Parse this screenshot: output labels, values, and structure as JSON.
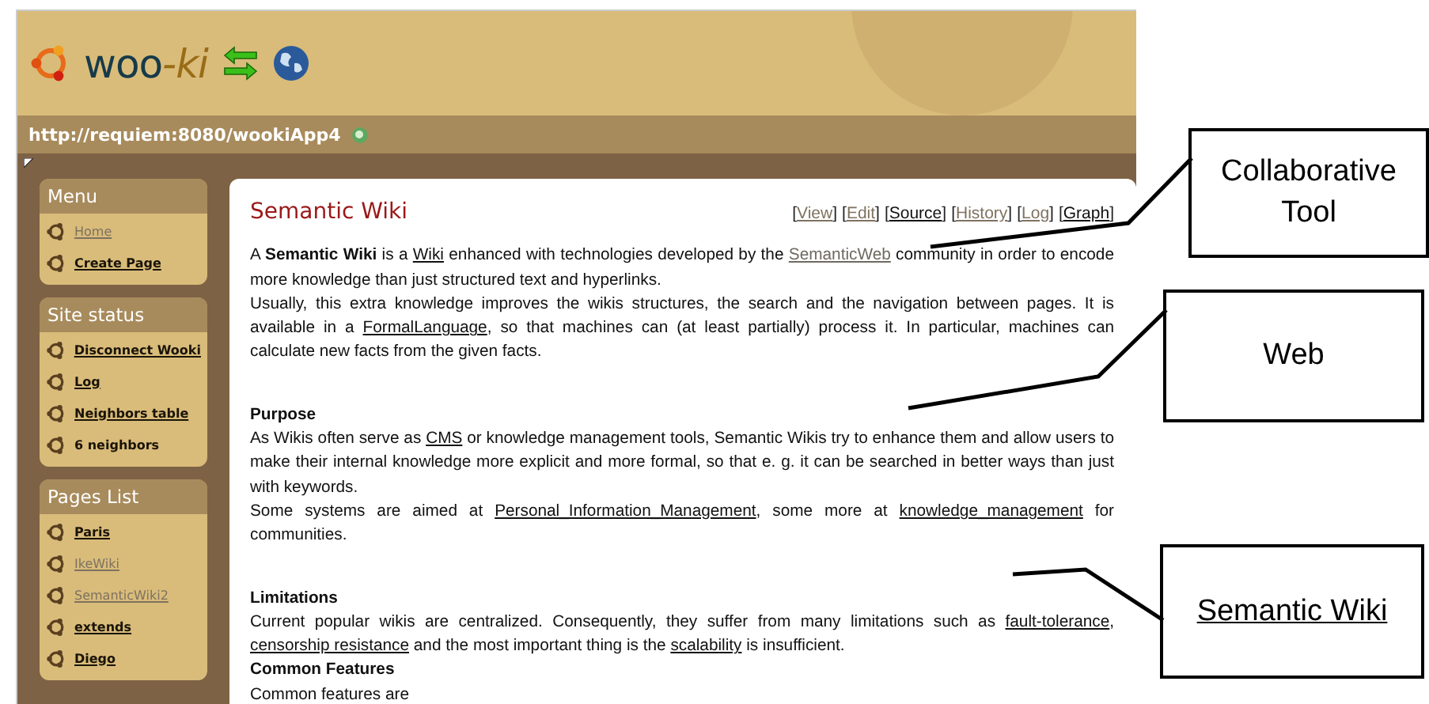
{
  "header": {
    "logo": [
      {
        "text": "woo",
        "kind": "plain"
      },
      {
        "text": "-ki",
        "kind": "accent"
      }
    ]
  },
  "address_bar": {
    "url": "http://requiem:8080/wookiApp4"
  },
  "sidebar": [
    {
      "title": "Menu",
      "items": [
        {
          "label": "Home",
          "kind": "link",
          "visited": true
        },
        {
          "label": "Create Page",
          "kind": "link",
          "visited": false
        }
      ]
    },
    {
      "title": "Site status",
      "items": [
        {
          "label": "Disconnect Wooki",
          "kind": "link",
          "visited": false
        },
        {
          "label": "Log",
          "kind": "link",
          "visited": false
        },
        {
          "label": "Neighbors table",
          "kind": "link",
          "visited": false
        },
        {
          "label": "6 neighbors",
          "kind": "text",
          "visited": false
        }
      ]
    },
    {
      "title": "Pages List",
      "items": [
        {
          "label": "Paris",
          "kind": "link",
          "visited": false
        },
        {
          "label": "IkeWiki",
          "kind": "link",
          "visited": true
        },
        {
          "label": "SemanticWiki2",
          "kind": "link",
          "visited": true
        },
        {
          "label": "extends",
          "kind": "link",
          "visited": false
        },
        {
          "label": "Diego",
          "kind": "link",
          "visited": false
        }
      ]
    }
  ],
  "page": {
    "title": "Semantic Wiki",
    "actions": [
      {
        "open": "[",
        "label": "View",
        "close": "]",
        "visited": true
      },
      {
        "open": "[",
        "label": "Edit",
        "close": "]",
        "visited": true
      },
      {
        "open": "[",
        "label": "Source",
        "close": "]",
        "visited": false
      },
      {
        "open": "[",
        "label": "History",
        "close": "]",
        "visited": true
      },
      {
        "open": "[",
        "label": "Log",
        "close": "]",
        "visited": true
      },
      {
        "open": "[",
        "label": "Graph",
        "close": "]",
        "visited": false
      }
    ],
    "sections": [
      {
        "paragraphs": [
          [
            {
              "kind": "text",
              "text": "A "
            },
            {
              "kind": "bold",
              "text": "Semantic Wiki"
            },
            {
              "kind": "text",
              "text": " is a "
            },
            {
              "kind": "link",
              "text": "Wiki",
              "visited": false
            },
            {
              "kind": "text",
              "text": " enhanced with technologies developed by the "
            },
            {
              "kind": "link",
              "text": "SemanticWeb",
              "visited": true
            },
            {
              "kind": "text",
              "text": " community in order to encode more knowledge than just structured text and hyperlinks."
            }
          ],
          [
            {
              "kind": "text",
              "text": "Usually, this extra knowledge improves the wikis structures, the search and the navigation between pages. It is available in a "
            },
            {
              "kind": "link",
              "text": "FormalLanguage",
              "visited": false
            },
            {
              "kind": "text",
              "text": ", so that machines can (at least partially) process it. In particular, machines can calculate new facts from the given facts."
            }
          ]
        ]
      },
      {
        "heading": "Purpose",
        "paragraphs": [
          [
            {
              "kind": "text",
              "text": "As Wikis often serve as "
            },
            {
              "kind": "link",
              "text": "CMS",
              "visited": false
            },
            {
              "kind": "text",
              "text": " or knowledge management tools, Semantic Wikis try to enhance them and allow users to make their internal knowledge more explicit and more formal, so that e. g. it can be searched in better ways than just with keywords."
            }
          ],
          [
            {
              "kind": "text",
              "text": "Some systems are aimed at "
            },
            {
              "kind": "link",
              "text": "Personal_Information_Management",
              "visited": false
            },
            {
              "kind": "text",
              "text": ", some more at "
            },
            {
              "kind": "link",
              "text": "knowledge_management",
              "visited": false
            },
            {
              "kind": "text",
              "text": " for communities."
            }
          ]
        ]
      },
      {
        "heading": "Limitations",
        "paragraphs": [
          [
            {
              "kind": "text",
              "text": "Current popular wikis are centralized. Consequently, they suffer from many limitations such as "
            },
            {
              "kind": "link",
              "text": "fault-tolerance",
              "visited": false
            },
            {
              "kind": "text",
              "text": ", "
            },
            {
              "kind": "link",
              "text": "censorship resistance",
              "visited": false
            },
            {
              "kind": "text",
              "text": " and the most important thing is the "
            },
            {
              "kind": "link",
              "text": "scalability",
              "visited": false
            },
            {
              "kind": "text",
              "text": " is insufficient."
            }
          ]
        ]
      },
      {
        "heading": "Common Features",
        "paragraphs": [
          [
            {
              "kind": "text",
              "text": "Common features are"
            }
          ]
        ]
      }
    ]
  },
  "callouts": [
    {
      "text": "Collaborative Tool",
      "underlined": false
    },
    {
      "text": "Web",
      "underlined": false
    },
    {
      "text": "Semantic Wiki",
      "underlined": true
    }
  ]
}
